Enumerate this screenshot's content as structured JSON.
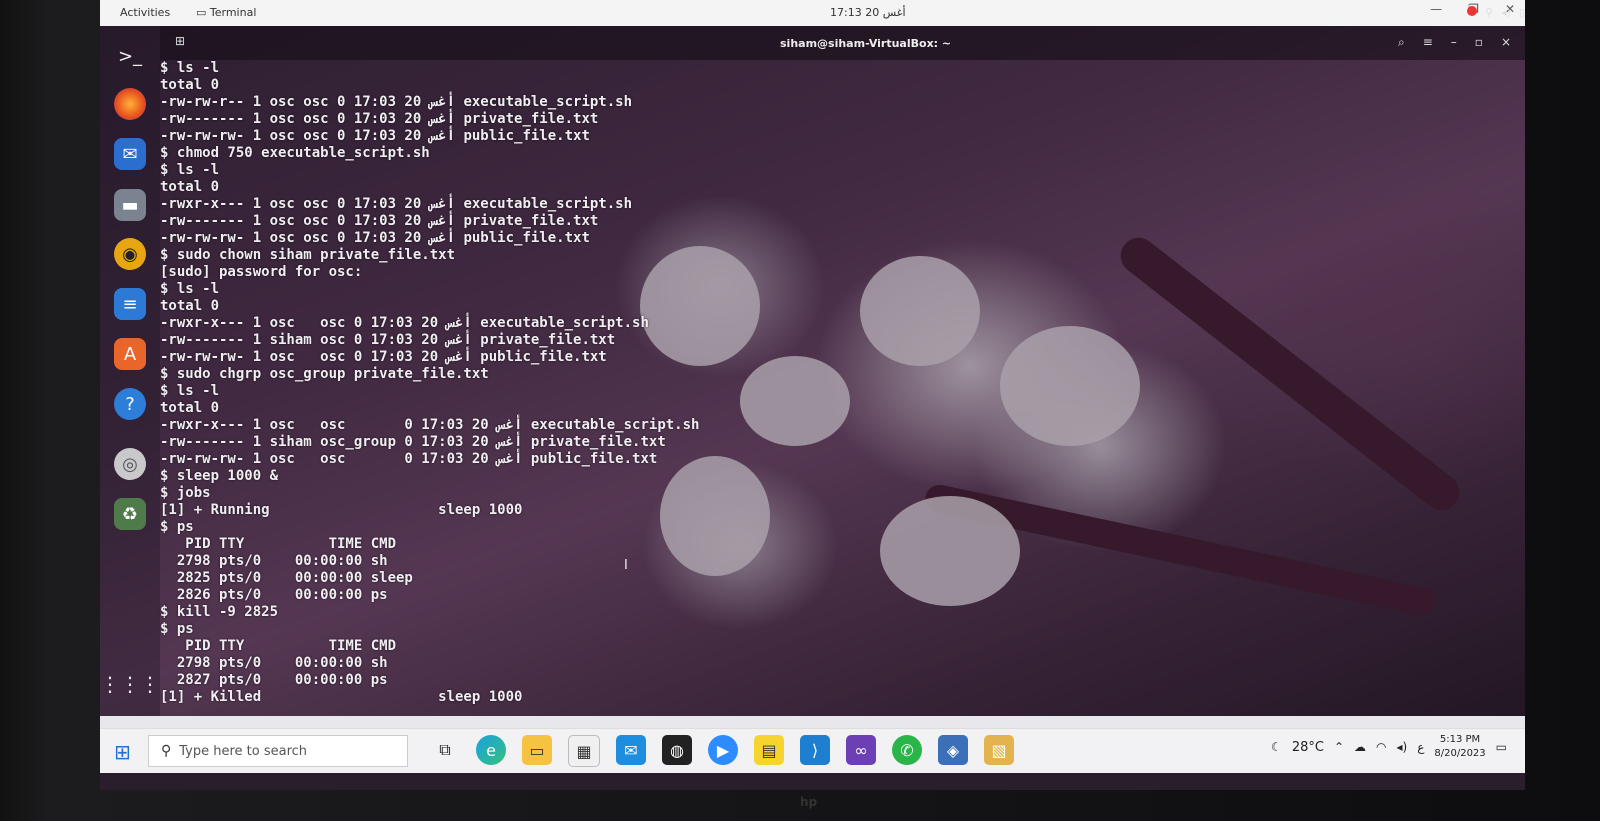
{
  "topbar": {
    "activities": "Activities",
    "terminal": "Terminal",
    "clock": "17:13 أغس 20"
  },
  "terminal": {
    "title": "siham@siham-VirtualBox: ~",
    "lines": [
      "$ ls -l",
      "total 0",
      "-rw-rw-r-- 1 osc osc 0 17:03 20 أغس executable_script.sh",
      "-rw------- 1 osc osc 0 17:03 20 أغس private_file.txt",
      "-rw-rw-rw- 1 osc osc 0 17:03 20 أغس public_file.txt",
      "$ chmod 750 executable_script.sh",
      "$ ls -l",
      "total 0",
      "-rwxr-x--- 1 osc osc 0 17:03 20 أغس executable_script.sh",
      "-rw------- 1 osc osc 0 17:03 20 أغس private_file.txt",
      "-rw-rw-rw- 1 osc osc 0 17:03 20 أغس public_file.txt",
      "$ sudo chown siham private_file.txt",
      "[sudo] password for osc:",
      "$ ls -l",
      "total 0",
      "-rwxr-x--- 1 osc   osc 0 17:03 20 أغس executable_script.sh",
      "-rw------- 1 siham osc 0 17:03 20 أغس private_file.txt",
      "-rw-rw-rw- 1 osc   osc 0 17:03 20 أغس public_file.txt",
      "$ sudo chgrp osc_group private_file.txt",
      "$ ls -l",
      "total 0",
      "-rwxr-x--- 1 osc   osc       0 17:03 20 أغس executable_script.sh",
      "-rw------- 1 siham osc_group 0 17:03 20 أغس private_file.txt",
      "-rw-rw-rw- 1 osc   osc       0 17:03 20 أغس public_file.txt",
      "$ sleep 1000 &",
      "$ jobs",
      "[1] + Running                    sleep 1000",
      "$ ps",
      "   PID TTY          TIME CMD",
      "  2798 pts/0    00:00:00 sh",
      "  2825 pts/0    00:00:00 sleep",
      "  2826 pts/0    00:00:00 ps",
      "$ kill -9 2825",
      "$ ps",
      "   PID TTY          TIME CMD",
      "  2798 pts/0    00:00:00 sh",
      "  2827 pts/0    00:00:00 ps",
      "[1] + Killed                     sleep 1000"
    ]
  },
  "taskbar": {
    "search_placeholder": "Type here to search",
    "temperature": "28°C",
    "time": "5:13 PM",
    "date": "8/20/2023",
    "lang": "ع"
  },
  "colors": {
    "terminal_text": "#f0eef2",
    "windows_blue": "#1f6fd6",
    "taskbar_bg": "#f2f2f5"
  }
}
